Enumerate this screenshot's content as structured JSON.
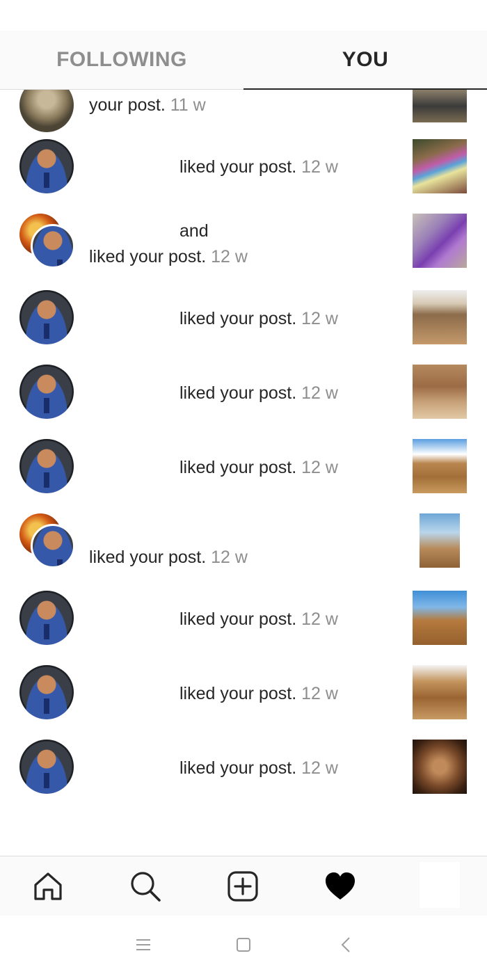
{
  "tabs": {
    "following": "FOLLOWING",
    "you": "YOU",
    "active": "YOU"
  },
  "notifications": [
    {
      "type": "single",
      "text": "your post.",
      "time": "11 w"
    },
    {
      "type": "single",
      "text": "liked your post.",
      "time": "12 w"
    },
    {
      "type": "group",
      "line1": "and",
      "text": "liked your post.",
      "time": "12 w"
    },
    {
      "type": "single",
      "text": "liked your post.",
      "time": "12 w"
    },
    {
      "type": "single",
      "text": "liked your post.",
      "time": "12 w"
    },
    {
      "type": "single",
      "text": "liked your post.",
      "time": "12 w"
    },
    {
      "type": "group",
      "text": "liked your post.",
      "time": "12 w"
    },
    {
      "type": "single",
      "text": "liked your post.",
      "time": "12 w"
    },
    {
      "type": "single",
      "text": "liked your post.",
      "time": "12 w"
    },
    {
      "type": "single",
      "text": "liked your post.",
      "time": "12 w"
    }
  ],
  "bottom_nav": {
    "items": [
      {
        "icon": "home-icon"
      },
      {
        "icon": "search-icon"
      },
      {
        "icon": "add-post-icon"
      },
      {
        "icon": "heart-icon",
        "active": true
      },
      {
        "icon": "profile-avatar"
      }
    ]
  },
  "system_nav": {
    "items": [
      "menu-icon",
      "home-square-icon",
      "back-chevron-icon"
    ]
  },
  "colors": {
    "text": "#262626",
    "secondary_text": "#8e8e8e",
    "border": "#dbdbdb",
    "nav_bg": "#fafafa"
  }
}
